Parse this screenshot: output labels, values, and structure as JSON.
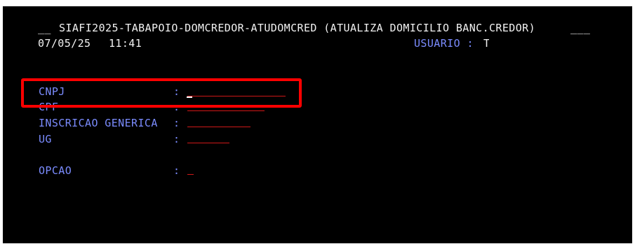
{
  "header": {
    "prefix": "__",
    "title": "SIAFI2025-TABAPOIO-DOMCREDOR-ATUDOMCRED (ATUALIZA DOMICILIO BANC.CREDOR)",
    "suffix": "___",
    "date": "07/05/25",
    "time": "11:41",
    "usuario_label": "USUARIO :",
    "usuario_value": "T"
  },
  "form": {
    "separator": ":",
    "fields": [
      {
        "label": "CNPJ",
        "value": ""
      },
      {
        "label": "CPF",
        "value": ""
      },
      {
        "label": "INSCRICAO GENERICA",
        "value": ""
      },
      {
        "label": "UG",
        "value": ""
      },
      {
        "label": "OPCAO",
        "value": ""
      }
    ]
  },
  "colors": {
    "background": "#000000",
    "label": "#7b8cff",
    "text": "#f2f2f2",
    "field_underline": "#d01818",
    "highlight": "#ff0000"
  }
}
